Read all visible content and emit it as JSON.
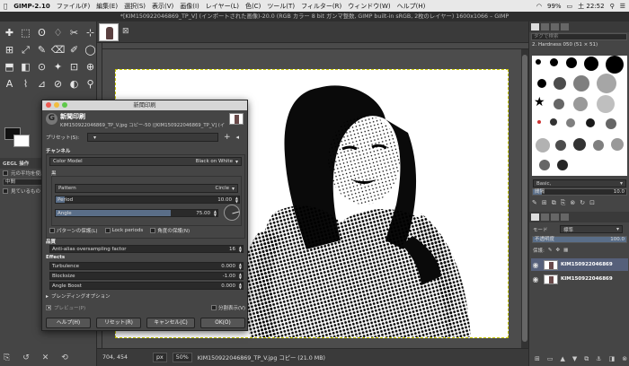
{
  "menubar": {
    "app": "GIMP-2.10",
    "items": [
      "ファイル(F)",
      "編集(E)",
      "選択(S)",
      "表示(V)",
      "画像(I)",
      "レイヤー(L)",
      "色(C)",
      "ツール(T)",
      "フィルター(R)",
      "ウィンドウ(W)",
      "ヘルプ(H)"
    ],
    "battery": "99%",
    "clock": "土 22:52"
  },
  "window": {
    "title": "*[KIM150922046869_TP_V] (インポートされた画像)-20.0 (RGB カラー 8 bit ガンマ整数, GIMP built-in sRGB, 2枚のレイヤー) 1600x1066 – GIMP"
  },
  "toolbox": {
    "tools": [
      "✚",
      "⬚",
      "ʘ",
      "♢",
      "✂",
      "⊹",
      "⊞",
      "⤢",
      "✎",
      "⌫",
      "✐",
      "◯",
      "⬒",
      "◧",
      "⊙",
      "✦",
      "⊡",
      "⊕",
      "A",
      "⌇",
      "⊿",
      "⊘",
      "◐",
      "⚲"
    ],
    "gegl_title": "GEGL 操作",
    "gegl_opt1": "元の平均を使用",
    "gegl_opt1b": "中間",
    "gegl_opt2": "見ているもの"
  },
  "status": {
    "coords": "704, 454",
    "unit": "px",
    "zoom": "50%",
    "info": "KIM150922046869_TP_V.jpg コピー (21.0 MB)"
  },
  "dock": {
    "filter_placeholder": "タグで検索",
    "brush_name": "2. Hardness 050 (51 × 51)",
    "preset_label": "Basic,",
    "spacing_label": "間隔",
    "spacing_value": "10.0",
    "mode_label": "モード",
    "mode_value": "標準",
    "opacity_label": "不透明度",
    "opacity_value": "100.0",
    "opacity_level": 1.0,
    "spacing_level": 0.1,
    "lock_label": "保護:",
    "layers": [
      {
        "name": "KIM150922046869",
        "active": true
      },
      {
        "name": "KIM150922046869",
        "active": false
      }
    ]
  },
  "dialog": {
    "window_title": "新聞印刷",
    "heading": "新聞印刷",
    "subheading": "KIM150922046869_TP_V.jpg コピー-50 ([KIM150922046869_TP_V] (イ",
    "preset_label": "プリセット(S):",
    "channel_section": "チャンネル",
    "color_model_label": "Color Model",
    "color_model_value": "Black on White",
    "black_label": "黒",
    "pattern_label": "Pattern",
    "pattern_value": "Circle",
    "period_label": "Period",
    "period_value": "10.00",
    "period_level": 0.05,
    "angle_label": "Angle",
    "angle_value": "75.00",
    "angle_level": 0.71,
    "lock_pattern": "パターンの保護(L)",
    "lock_periods": "Lock periods",
    "lock_angle": "角度の保護(N)",
    "quality_section": "品質",
    "aa_label": "Anti-alias oversampling factor",
    "aa_value": "16",
    "effects_section": "Effects",
    "turbulence_label": "Turbulence",
    "turbulence_value": "0.000",
    "blocksize_label": "Blocksize",
    "blocksize_value": "-1.00",
    "angleboost_label": "Angle Boost",
    "angleboost_value": "0.000",
    "blending_label": "ブレンディングオプション",
    "preview_label": "プレビュー(P)",
    "split_label": "分割表示(V)",
    "btn_help": "ヘルプ(H)",
    "btn_reset": "リセット(R)",
    "btn_cancel": "キャンセル(C)",
    "btn_ok": "OK(O)"
  }
}
